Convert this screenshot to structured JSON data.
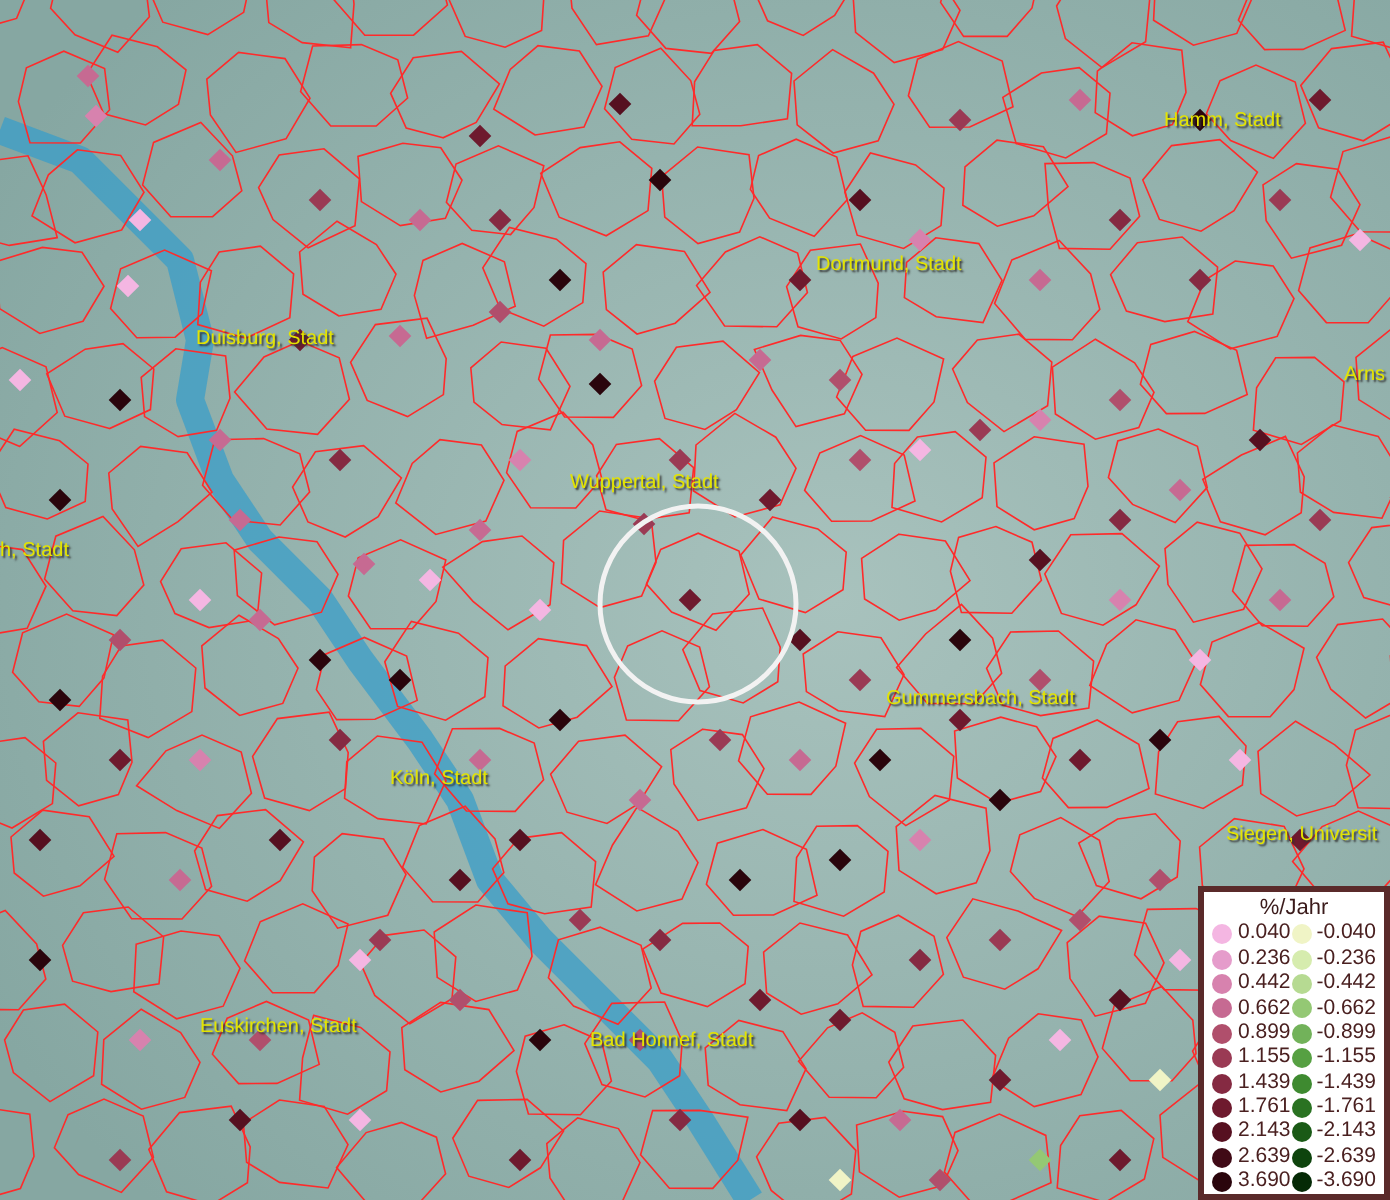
{
  "places": [
    {
      "name": "Hamm, Stadt"
    },
    {
      "name": "Dortmund, Stadt"
    },
    {
      "name": "Duisburg, Stadt"
    },
    {
      "name": "Arns"
    },
    {
      "name": "Wuppertal, Stadt"
    },
    {
      "name": "h, Stadt"
    },
    {
      "name": "Gummersbach, Stadt"
    },
    {
      "name": "Köln, Stadt"
    },
    {
      "name": "Siegen, Universit"
    },
    {
      "name": "Euskirchen, Stadt"
    },
    {
      "name": "Bad Honnef, Stadt"
    }
  ],
  "legend": {
    "title": "%/Jahr",
    "rows": [
      {
        "positive": {
          "value": "0.040",
          "color": "#f4b6e2"
        },
        "negative": {
          "value": "-0.040",
          "color": "#f0f4c6"
        }
      },
      {
        "positive": {
          "value": "0.236",
          "color": "#e59ccb"
        },
        "negative": {
          "value": "-0.236",
          "color": "#d6ecae"
        }
      },
      {
        "positive": {
          "value": "0.442",
          "color": "#d782ae"
        },
        "negative": {
          "value": "-0.442",
          "color": "#b6da92"
        }
      },
      {
        "positive": {
          "value": "0.662",
          "color": "#c66a92"
        },
        "negative": {
          "value": "-0.662",
          "color": "#94c874"
        }
      },
      {
        "positive": {
          "value": "0.899",
          "color": "#b04f6c"
        },
        "negative": {
          "value": "-0.899",
          "color": "#72b25a"
        }
      },
      {
        "positive": {
          "value": "1.155",
          "color": "#9a3a54"
        },
        "negative": {
          "value": "-1.155",
          "color": "#56a042"
        }
      },
      {
        "positive": {
          "value": "1.439",
          "color": "#852a42"
        },
        "negative": {
          "value": "-1.439",
          "color": "#3e8a30"
        }
      },
      {
        "positive": {
          "value": "1.761",
          "color": "#6e1a2e"
        },
        "negative": {
          "value": "-1.761",
          "color": "#2a7222"
        }
      },
      {
        "positive": {
          "value": "2.143",
          "color": "#561020"
        },
        "negative": {
          "value": "-2.143",
          "color": "#1a5a16"
        }
      },
      {
        "positive": {
          "value": "2.639",
          "color": "#400a16"
        },
        "negative": {
          "value": "-2.639",
          "color": "#0e440d"
        }
      },
      {
        "positive": {
          "value": "3.690",
          "color": "#2a050c"
        },
        "negative": {
          "value": "-3.690",
          "color": "#052a06"
        }
      }
    ]
  }
}
